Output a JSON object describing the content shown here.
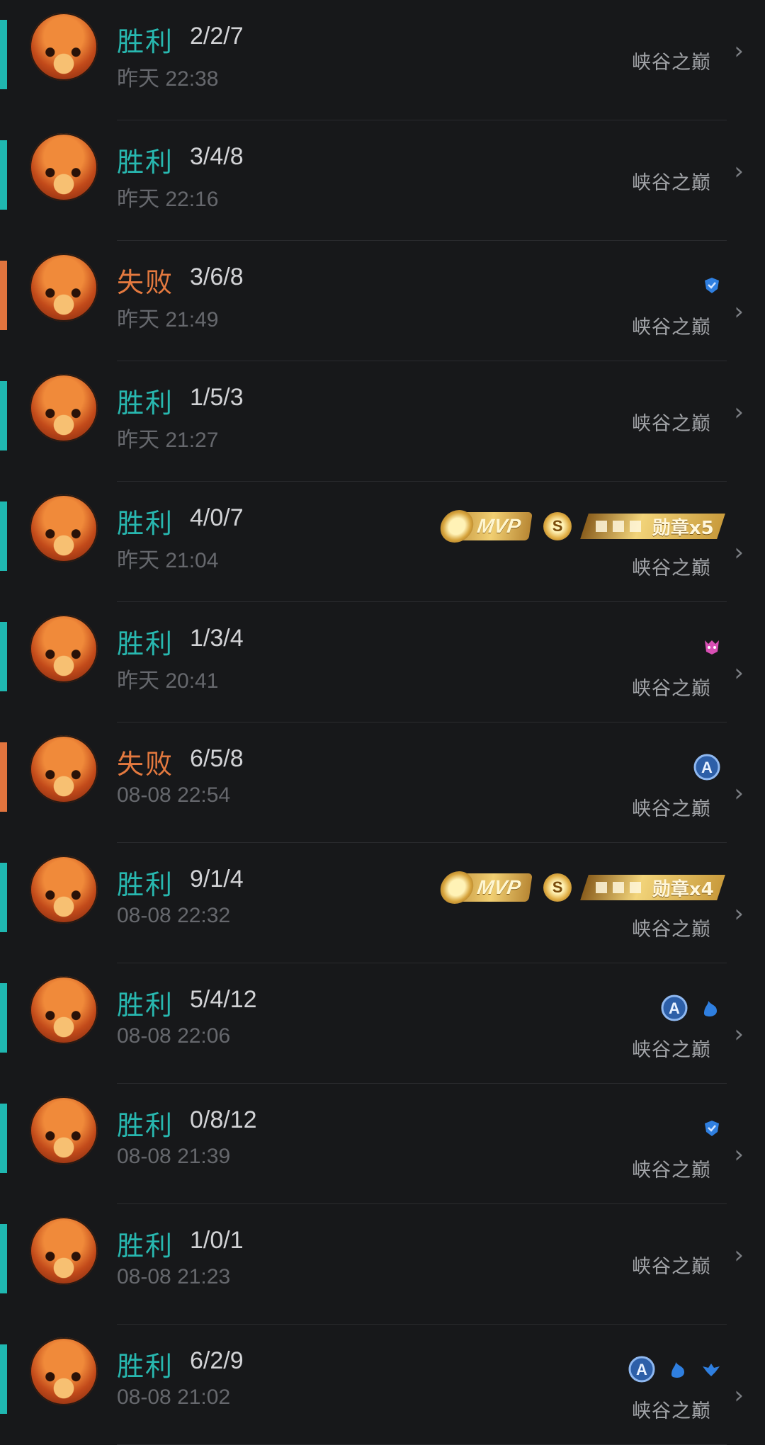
{
  "matches": [
    {
      "result": "胜利",
      "outcome": "win",
      "kda": "2/2/7",
      "time": "昨天 22:38",
      "mode": "峡谷之巅",
      "badges": []
    },
    {
      "result": "胜利",
      "outcome": "win",
      "kda": "3/4/8",
      "time": "昨天 22:16",
      "mode": "峡谷之巅",
      "badges": []
    },
    {
      "result": "失败",
      "outcome": "loss",
      "kda": "3/6/8",
      "time": "昨天 21:49",
      "mode": "峡谷之巅",
      "badges": [
        "blue-shield-icon"
      ]
    },
    {
      "result": "胜利",
      "outcome": "win",
      "kda": "1/5/3",
      "time": "昨天 21:27",
      "mode": "峡谷之巅",
      "badges": []
    },
    {
      "result": "胜利",
      "outcome": "win",
      "kda": "4/0/7",
      "time": "昨天 21:04",
      "mode": "峡谷之巅",
      "badges": [
        "mvp-badge",
        "s-coin-icon",
        "medal-banner"
      ],
      "mvp_label": "MVP",
      "medal_label": "勋章x5"
    },
    {
      "result": "胜利",
      "outcome": "win",
      "kda": "1/3/4",
      "time": "昨天 20:41",
      "mode": "峡谷之巅",
      "badges": [
        "pink-demon-icon"
      ]
    },
    {
      "result": "失败",
      "outcome": "loss",
      "kda": "6/5/8",
      "time": "08-08 22:54",
      "mode": "峡谷之巅",
      "badges": [
        "a-circle-icon"
      ]
    },
    {
      "result": "胜利",
      "outcome": "win",
      "kda": "9/1/4",
      "time": "08-08 22:32",
      "mode": "峡谷之巅",
      "badges": [
        "mvp-badge",
        "s-coin-icon",
        "medal-banner"
      ],
      "mvp_label": "MVP",
      "medal_label": "勋章x4"
    },
    {
      "result": "胜利",
      "outcome": "win",
      "kda": "5/4/12",
      "time": "08-08 22:06",
      "mode": "峡谷之巅",
      "badges": [
        "a-circle-icon",
        "blue-fire-icon"
      ]
    },
    {
      "result": "胜利",
      "outcome": "win",
      "kda": "0/8/12",
      "time": "08-08 21:39",
      "mode": "峡谷之巅",
      "badges": [
        "blue-shield-icon"
      ]
    },
    {
      "result": "胜利",
      "outcome": "win",
      "kda": "1/0/1",
      "time": "08-08 21:23",
      "mode": "峡谷之巅",
      "badges": []
    },
    {
      "result": "胜利",
      "outcome": "win",
      "kda": "6/2/9",
      "time": "08-08 21:02",
      "mode": "峡谷之巅",
      "badges": [
        "a-circle-icon",
        "blue-fire-icon",
        "blue-wing-icon"
      ]
    }
  ],
  "colors": {
    "win": "#1fb7b0",
    "loss": "#e1743e",
    "background": "#17181a"
  }
}
